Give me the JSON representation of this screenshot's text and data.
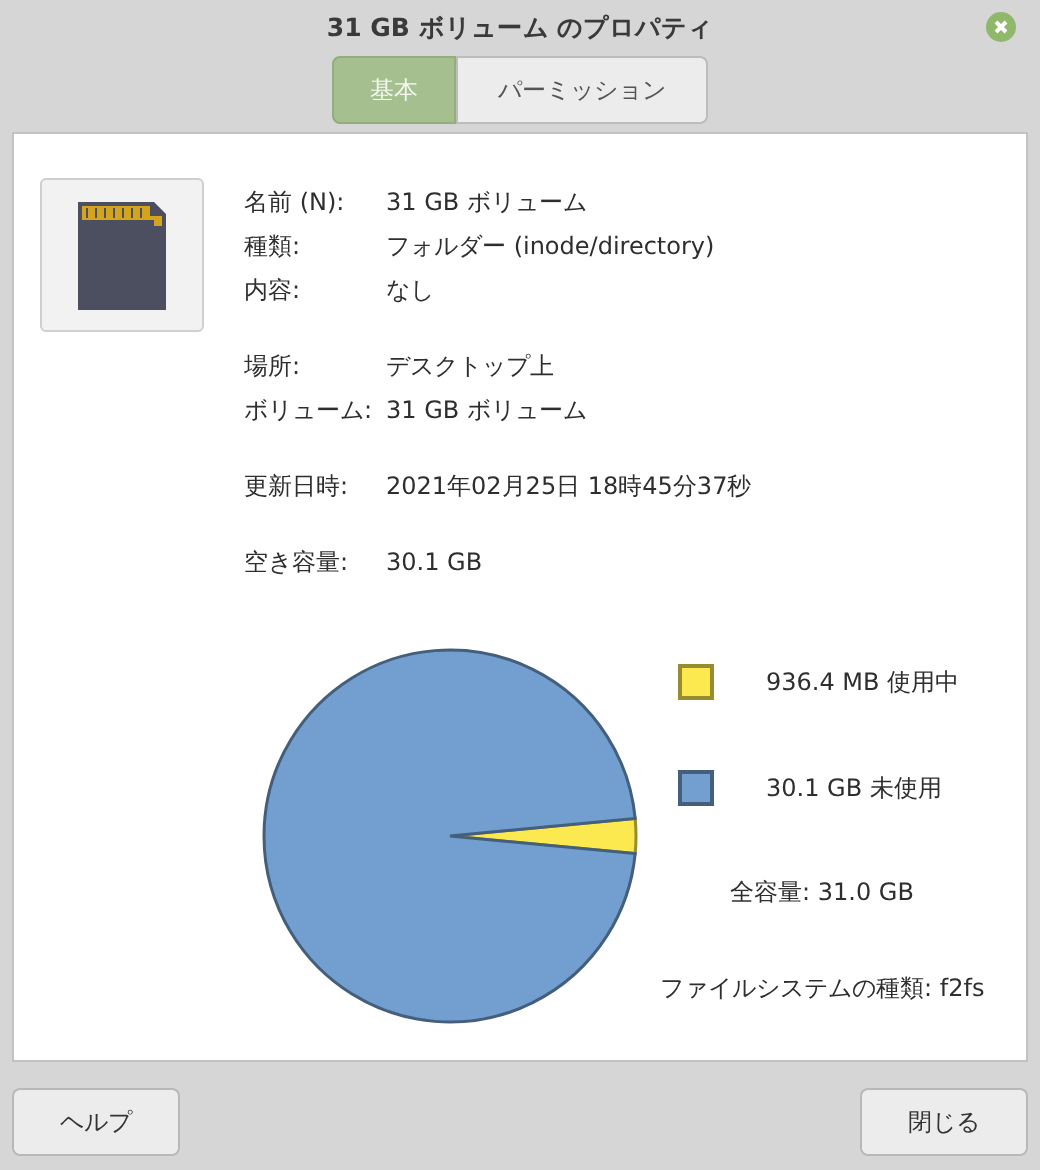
{
  "window": {
    "title": "31 GB ボリューム のプロパティ"
  },
  "tabs": [
    {
      "label": "基本",
      "selected": true
    },
    {
      "label": "パーミッション",
      "selected": false
    }
  ],
  "info_groups": [
    [
      {
        "label": "名前 (N):",
        "value": "31 GB ボリューム"
      },
      {
        "label": "種類:",
        "value": "フォルダー (inode/directory)"
      },
      {
        "label": "内容:",
        "value": "なし"
      }
    ],
    [
      {
        "label": "場所:",
        "value": "デスクトップ上"
      },
      {
        "label": "ボリューム:",
        "value": "31 GB ボリューム"
      }
    ],
    [
      {
        "label": "更新日時:",
        "value": "2021年02月25日 18時45分37秒"
      }
    ],
    [
      {
        "label": "空き容量:",
        "value": "30.1 GB"
      }
    ]
  ],
  "usage": {
    "chart_data": {
      "type": "pie",
      "values": [
        3.0,
        97.0
      ]
    },
    "legend": [
      {
        "text": "936.4 MB 使用中",
        "color": "#fce94f"
      },
      {
        "text": "30.1 GB 未使用",
        "color": "#729fcf"
      }
    ],
    "total": "全容量: 31.0 GB",
    "filesystem": "ファイルシステムの種類: f2fs"
  },
  "buttons": [
    {
      "label": "ヘルプ"
    },
    {
      "label": "閉じる"
    }
  ]
}
